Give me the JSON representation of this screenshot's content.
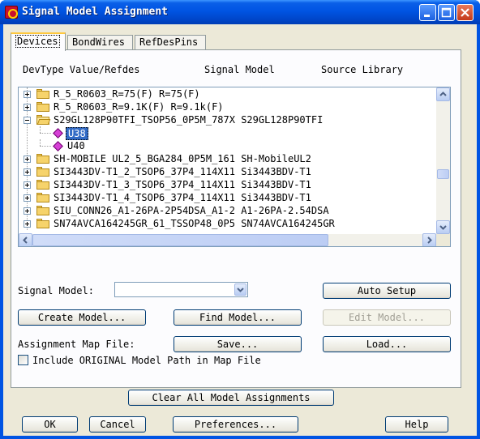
{
  "window": {
    "title": "Signal Model Assignment"
  },
  "tabs": [
    {
      "label": "Devices",
      "active": true
    },
    {
      "label": "BondWires",
      "active": false
    },
    {
      "label": "RefDesPins",
      "active": false
    }
  ],
  "columns": {
    "devtype": "DevType Value/Refdes",
    "signal_model": "Signal Model",
    "source_library": "Source Library"
  },
  "tree": {
    "rows": [
      {
        "text": "R_5_R0603_R=75(F) R=75(F)",
        "kind": "folder",
        "expand": "plus"
      },
      {
        "text": "R_5_R0603_R=9.1K(F) R=9.1k(F)",
        "kind": "folder",
        "expand": "plus"
      },
      {
        "text": "S29GL128P90TFI_TSOP56_0P5M_787X S29GL128P90TFI",
        "kind": "folder-open",
        "expand": "minus"
      },
      {
        "text": "U38",
        "kind": "pin",
        "selected": true
      },
      {
        "text": "U40",
        "kind": "pin",
        "selected": false
      },
      {
        "text": "SH-MOBILE UL2_5_BGA284_0P5M_161 SH-MobileUL2",
        "kind": "folder",
        "expand": "plus"
      },
      {
        "text": "SI3443DV-T1_2_TSOP6_37P4_114X11 Si3443BDV-T1",
        "kind": "folder",
        "expand": "plus"
      },
      {
        "text": "SI3443DV-T1_3_TSOP6_37P4_114X11 Si3443BDV-T1",
        "kind": "folder",
        "expand": "plus"
      },
      {
        "text": "SI3443DV-T1_4_TSOP6_37P4_114X11 Si3443BDV-T1",
        "kind": "folder",
        "expand": "plus"
      },
      {
        "text": "SIU_CONN26_A1-26PA-2P54DSA_A1-2 A1-26PA-2.54DSA",
        "kind": "folder",
        "expand": "plus"
      },
      {
        "text": "SN74AVCA164245GR_61_TSSOP48_0P5 SN74AVCA164245GR",
        "kind": "folder",
        "expand": "plus"
      }
    ]
  },
  "signal_model": {
    "label": "Signal Model:",
    "value": ""
  },
  "buttons": {
    "auto_setup": "Auto Setup",
    "create_model": "Create Model...",
    "find_model": "Find Model...",
    "edit_model": "Edit Model...",
    "save": "Save...",
    "load": "Load...",
    "clear_all": "Clear All Model Assignments",
    "ok": "OK",
    "cancel": "Cancel",
    "preferences": "Preferences...",
    "help": "Help"
  },
  "assignment_map": {
    "label": "Assignment Map File:"
  },
  "include_checkbox": {
    "label": "Include ORIGINAL Model Path in Map File",
    "checked": false
  },
  "icons": {
    "app": "app-icon",
    "minimize": "minimize-icon",
    "maximize": "maximize-icon",
    "close": "close-icon",
    "folder": "folder-icon",
    "pin": "pin-icon"
  }
}
